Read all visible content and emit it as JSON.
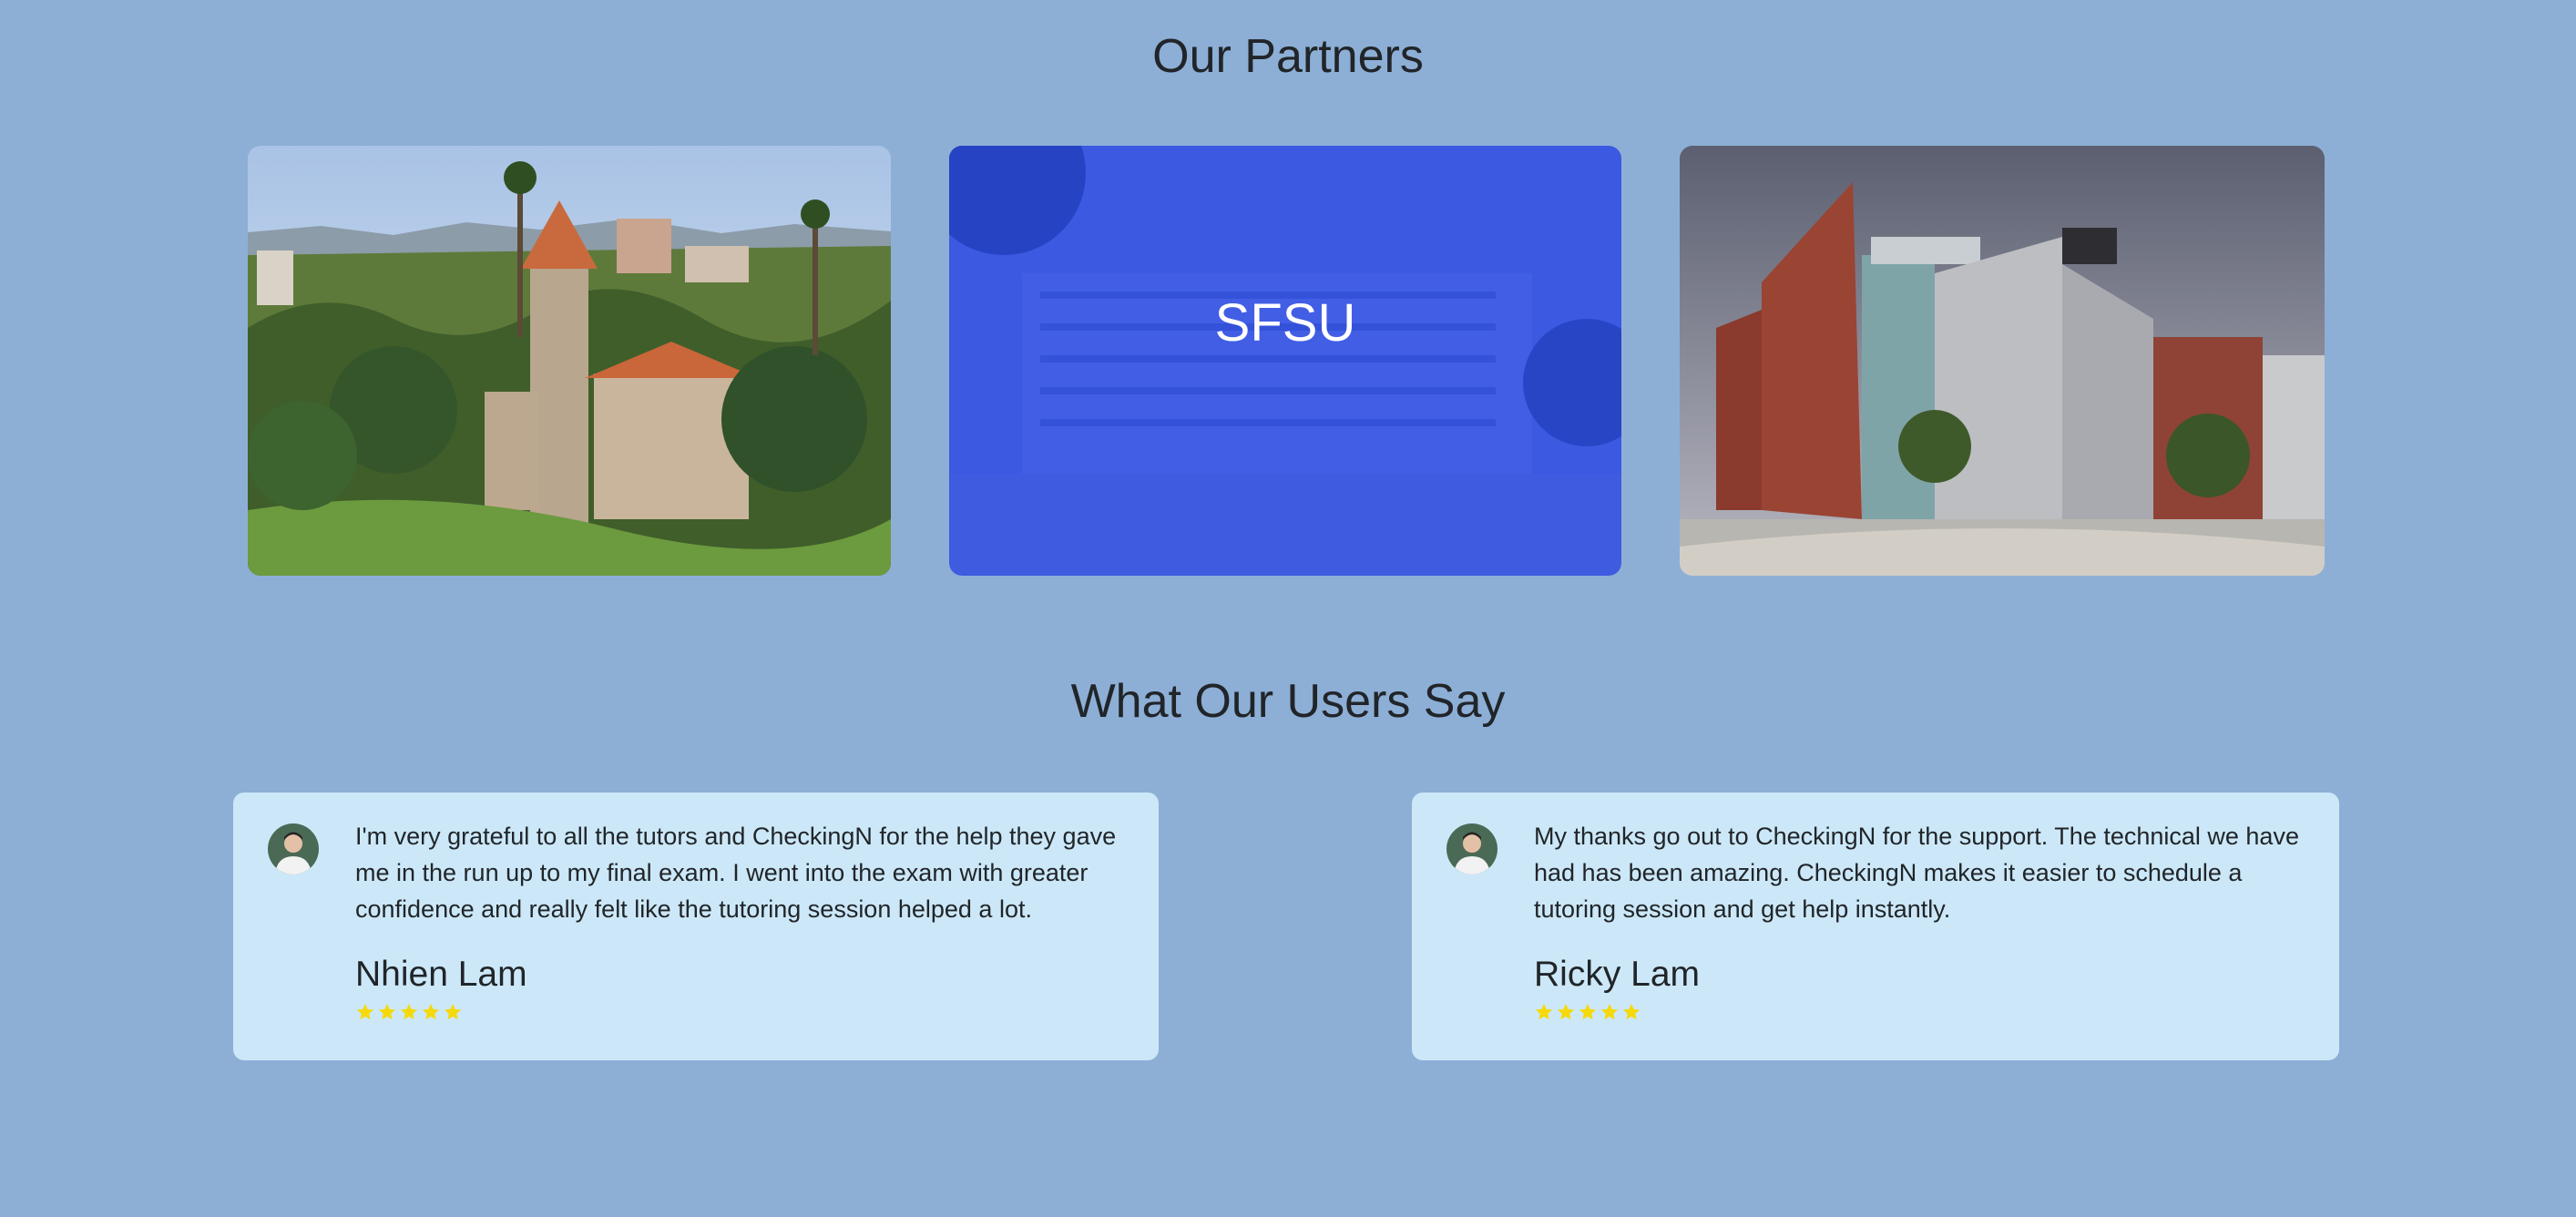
{
  "partners": {
    "title": "Our Partners",
    "cards": [
      {
        "image": "campus-tower-photo"
      },
      {
        "image": "campus-building-photo",
        "label": "SFSU",
        "overlay_color": "#2444e6"
      },
      {
        "image": "engineering-building-photo"
      }
    ]
  },
  "testimonials": {
    "title": "What Our Users Say",
    "items": [
      {
        "quote": "I'm very grateful to all the tutors and CheckingN for the help they gave me in the run up to my final exam. I went into the exam with greater confidence and really felt like the tutoring session helped a lot.",
        "name": "Nhien Lam",
        "rating": 5,
        "avatar_icon": "avatar-photo"
      },
      {
        "quote": "My thanks go out to CheckingN for the support. The technical we have had has been amazing. CheckingN makes it easier to schedule a tutoring session and get help instantly.",
        "name": "Ricky Lam",
        "rating": 5,
        "avatar_icon": "avatar-photo"
      }
    ]
  },
  "colors": {
    "page_background": "#8dafd6",
    "card_background": "#cce8f8",
    "star": "#f5d90a",
    "overlay": "#2444e6"
  }
}
